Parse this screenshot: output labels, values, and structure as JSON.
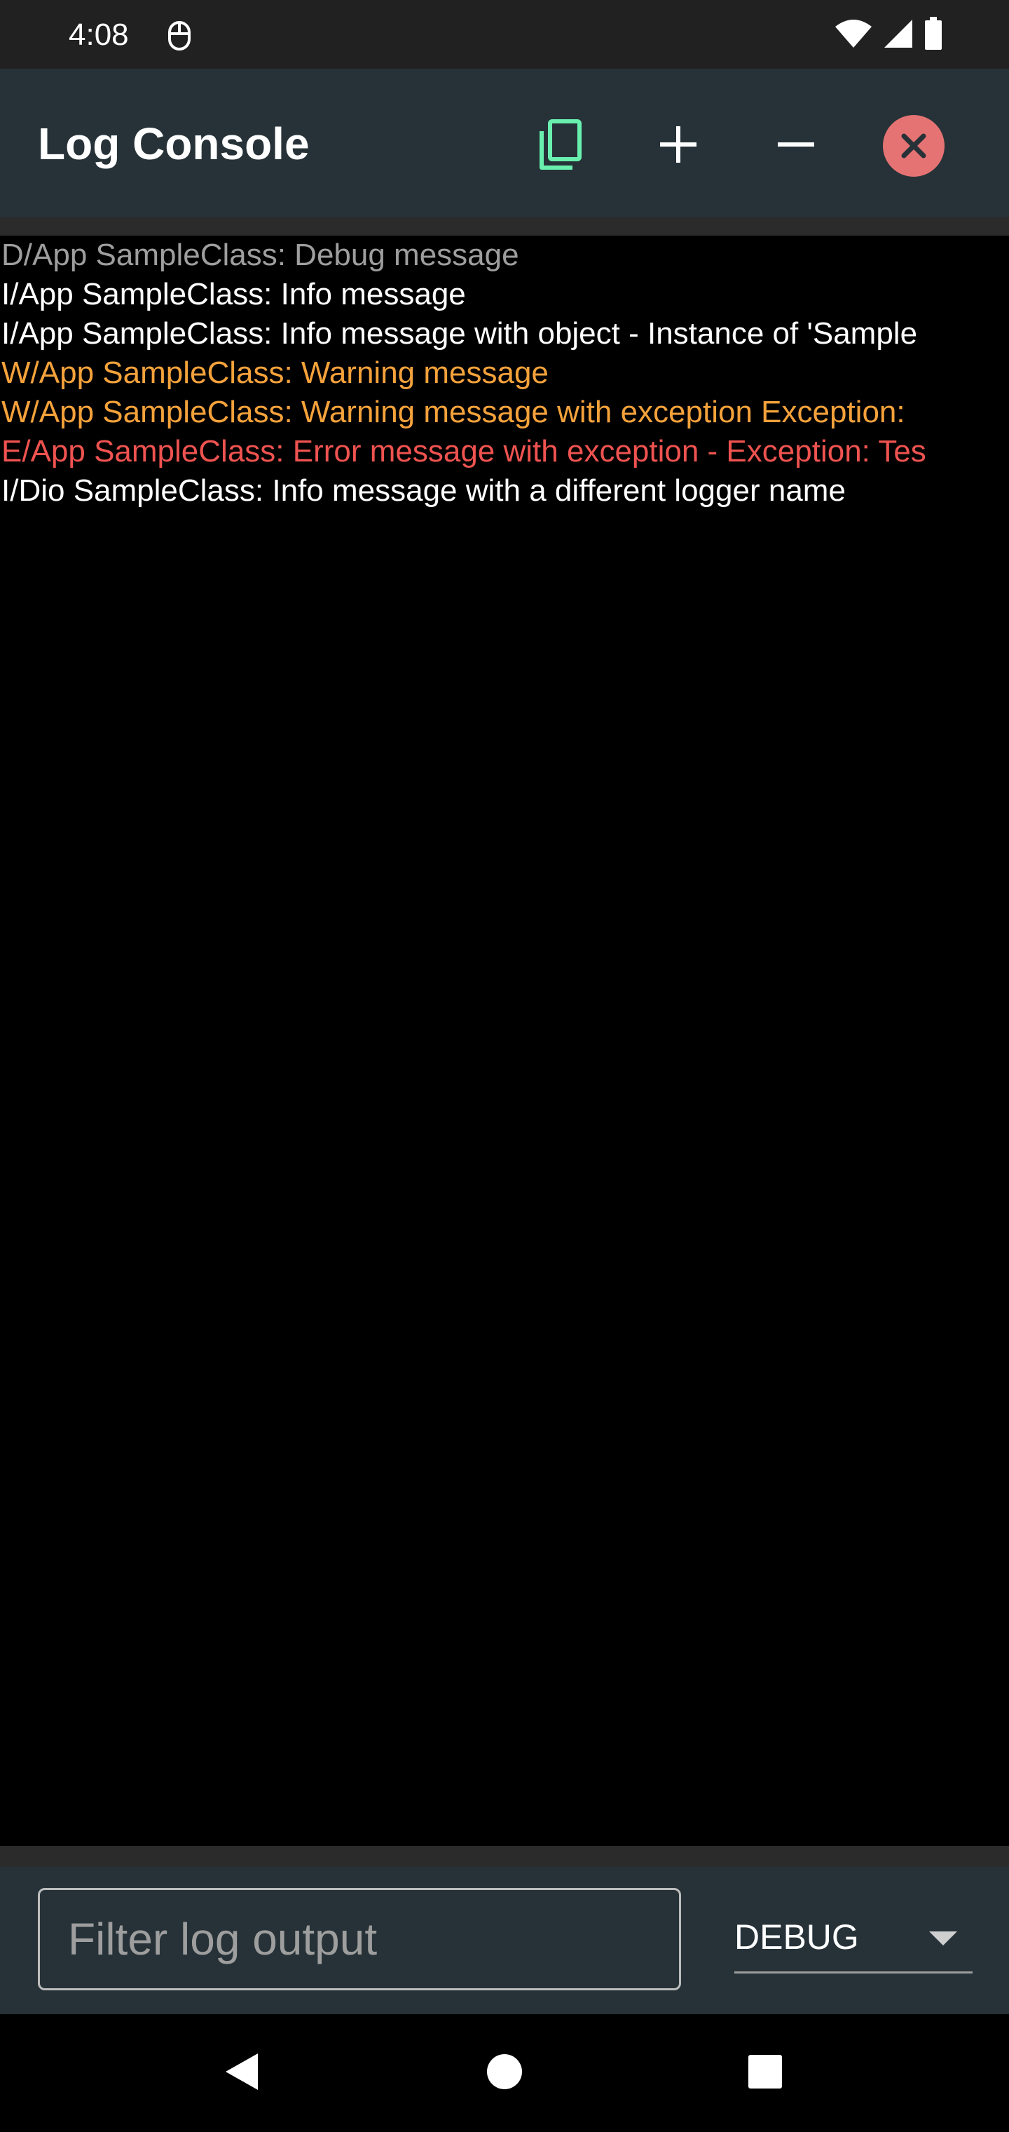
{
  "status_bar": {
    "time": "4:08",
    "icons": [
      "mouse-icon",
      "wifi-icon",
      "signal-icon",
      "battery-icon"
    ]
  },
  "app_bar": {
    "title": "Log Console",
    "actions": [
      {
        "name": "copy",
        "icon": "copy-icon",
        "color": "#69f0ae"
      },
      {
        "name": "zoom-in",
        "icon": "plus-icon",
        "color": "#ffffff"
      },
      {
        "name": "zoom-out",
        "icon": "minus-icon",
        "color": "#ffffff"
      },
      {
        "name": "close",
        "icon": "close-icon",
        "color": "#e57373"
      }
    ]
  },
  "logs": [
    {
      "level": "debug",
      "text": "D/App SampleClass: Debug message"
    },
    {
      "level": "info",
      "text": "I/App SampleClass: Info message"
    },
    {
      "level": "info",
      "text": "I/App SampleClass: Info message with object - Instance of 'Sample"
    },
    {
      "level": "warn",
      "text": "W/App SampleClass: Warning message"
    },
    {
      "level": "warn",
      "text": "W/App SampleClass: Warning message with exception Exception:"
    },
    {
      "level": "error",
      "text": "E/App SampleClass: Error message with exception - Exception: Tes"
    },
    {
      "level": "info",
      "text": "I/Dio SampleClass: Info message with a different logger name"
    }
  ],
  "colors": {
    "debug": "#9e9e9e",
    "info": "#ffffff",
    "warn": "#f5a23b",
    "error": "#ef5350",
    "app_bar": "#263238",
    "background": "#000000"
  },
  "filter": {
    "placeholder": "Filter log output",
    "value": ""
  },
  "level_select": {
    "selected": "DEBUG"
  },
  "nav_bar": {
    "buttons": [
      "back-icon",
      "home-icon",
      "recent-apps-icon"
    ]
  }
}
